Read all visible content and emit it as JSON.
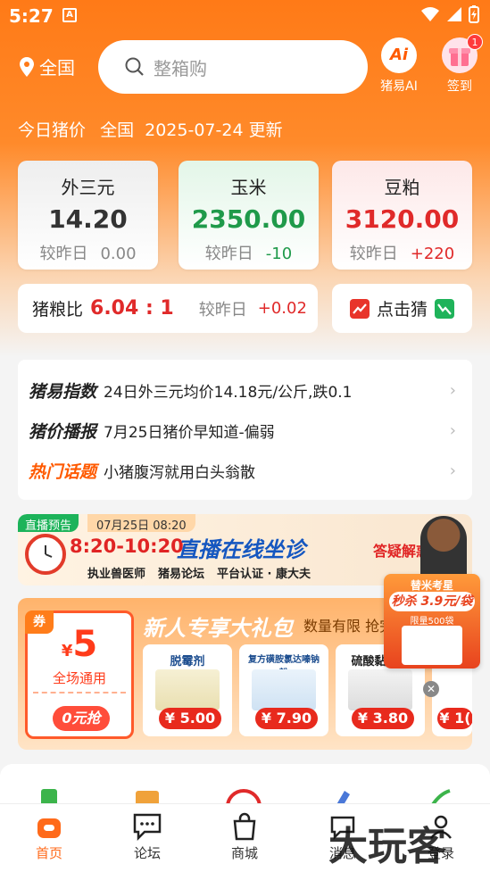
{
  "status": {
    "time": "5:27",
    "notif_icon": "A"
  },
  "header": {
    "location": "全国",
    "search_placeholder": "整箱购",
    "ai_label": "猪易AI",
    "ai_logo": "Ai",
    "signin_label": "签到",
    "signin_badge": "1"
  },
  "headline": {
    "title": "今日猪价",
    "region": "全国",
    "date_update": "2025-07-24 更新"
  },
  "cards": [
    {
      "name": "外三元",
      "value": "14.20",
      "compare_label": "较昨日",
      "change": "0.00",
      "color": "#333333",
      "change_color": "#888888"
    },
    {
      "name": "玉米",
      "value": "2350.00",
      "compare_label": "较昨日",
      "change": "-10",
      "color": "#1f9a4a",
      "change_color": "#1f9a4a"
    },
    {
      "name": "豆粕",
      "value": "3120.00",
      "compare_label": "较昨日",
      "change": "+220",
      "color": "#e02a2a",
      "change_color": "#e02a2a"
    }
  ],
  "ratio": {
    "label": "猪粮比",
    "value": "6.04 : 1",
    "compare_label": "较昨日",
    "change": "+0.02"
  },
  "guess": {
    "label": "点击猜"
  },
  "news": [
    {
      "tag": "猪易指数",
      "text": "24日外三元均价14.18元/公斤,跌0.1"
    },
    {
      "tag": "猪价播报",
      "text": "7月25日猪价早知道-偏弱"
    },
    {
      "tag": "热门话题",
      "text": "小猪腹泻就用白头翁散"
    }
  ],
  "live_banner": {
    "badge": "直播预告",
    "time": "07月25日 08:20",
    "slot": "8:20-10:20",
    "title": "直播在线坐诊",
    "subtitle": "答疑解惑",
    "strip": [
      "执业兽医师",
      "猪易论坛",
      "平台认证 · 康大夫"
    ]
  },
  "gift": {
    "title": "新人专享大礼包",
    "limit": "数量有限 抢完",
    "coupon": {
      "tag": "券",
      "currency": "¥",
      "amount": "5",
      "scope": "全场通用",
      "button": "0元抢"
    },
    "products": [
      {
        "title": "脱霉剂",
        "price": "¥ 5.00"
      },
      {
        "title": "复方磺胺氯达嗪钠粉",
        "price": "¥ 7.90"
      },
      {
        "title": "硫酸黏菌素",
        "price": "¥ 3.80"
      },
      {
        "title": "",
        "price": "¥ 1("
      }
    ]
  },
  "float_ad": {
    "line1": "替米考星",
    "line2": "秒杀 3.9元/袋",
    "line3": "限量500袋"
  },
  "tabs": [
    {
      "label": "首页",
      "icon": "home-icon"
    },
    {
      "label": "论坛",
      "icon": "forum-icon"
    },
    {
      "label": "商城",
      "icon": "shop-bag-icon"
    },
    {
      "label": "消息",
      "icon": "message-icon"
    },
    {
      "label": "登录",
      "icon": "user-icon"
    }
  ],
  "watermark": "大玩客",
  "colors": {
    "brand": "#ff7a17",
    "active_tab": "#ff6a1a",
    "down": "#1f9a4a",
    "up": "#e02a2a"
  }
}
